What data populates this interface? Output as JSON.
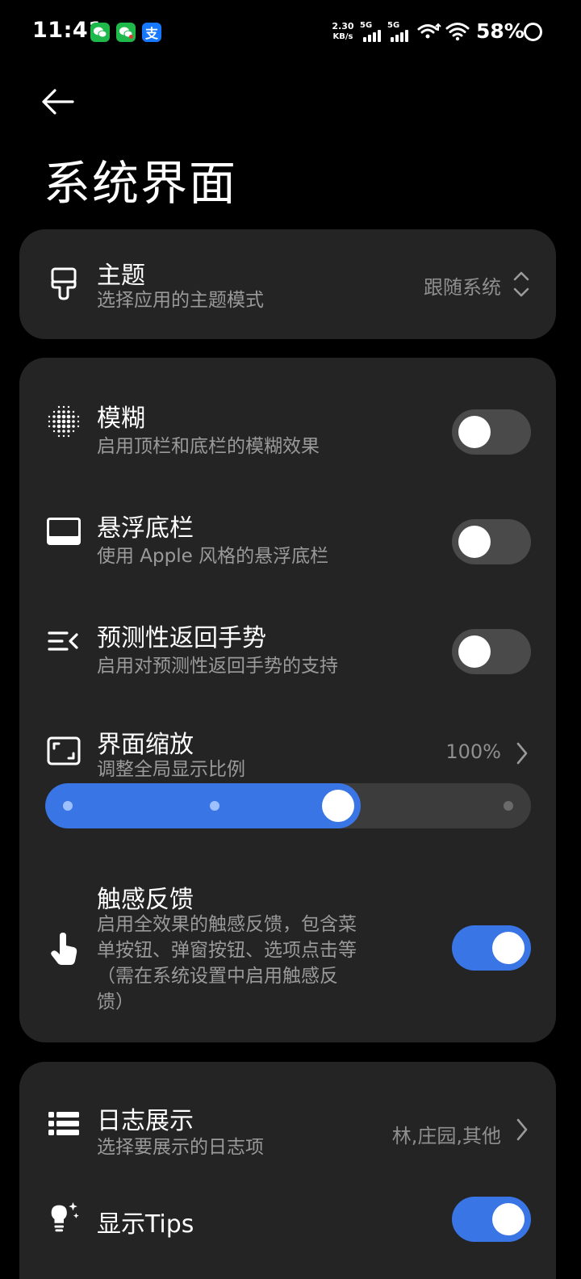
{
  "status_bar": {
    "time": "11:41",
    "apps": [
      "wechat-icon",
      "wechat-icon",
      "alipay-icon"
    ],
    "alipay_glyph": "支",
    "net_speed_value": "2.30",
    "net_speed_unit": "KB/s",
    "sim1_label": "5G",
    "sim2_label": "5G",
    "battery": "58%"
  },
  "header": {
    "title": "系统界面"
  },
  "theme_card": {
    "title": "主题",
    "subtitle": "选择应用的主题模式",
    "value": "跟随系统"
  },
  "display_card": {
    "blur": {
      "title": "模糊",
      "subtitle": "启用顶栏和底栏的模糊效果",
      "enabled": false
    },
    "floating_bar": {
      "title": "悬浮底栏",
      "subtitle": "使用 Apple 风格的悬浮底栏",
      "enabled": false
    },
    "predictive_back": {
      "title": "预测性返回手势",
      "subtitle": "启用对预测性返回手势的支持",
      "enabled": false
    },
    "scale": {
      "title": "界面缩放",
      "subtitle": "调整全局显示比例",
      "value": "100%",
      "slider_fraction": 0.65
    },
    "haptics": {
      "title": "触感反馈",
      "subtitle_lines": [
        "启用全效果的触感反馈，包含菜",
        "单按钮、弹窗按钮、选项点击等",
        "（需在系统设置中启用触感反",
        "馈）"
      ],
      "enabled": true
    }
  },
  "log_card": {
    "log": {
      "title": "日志展示",
      "subtitle": "选择要展示的日志项",
      "value": "林,庄园,其他"
    },
    "tips": {
      "title": "显示Tips",
      "enabled": true
    }
  },
  "colors": {
    "background": "#000000",
    "card": "#242424",
    "accent": "#3a75e6",
    "toggle_off": "#4a4a4a",
    "secondary_text": "#9a9a9a"
  }
}
